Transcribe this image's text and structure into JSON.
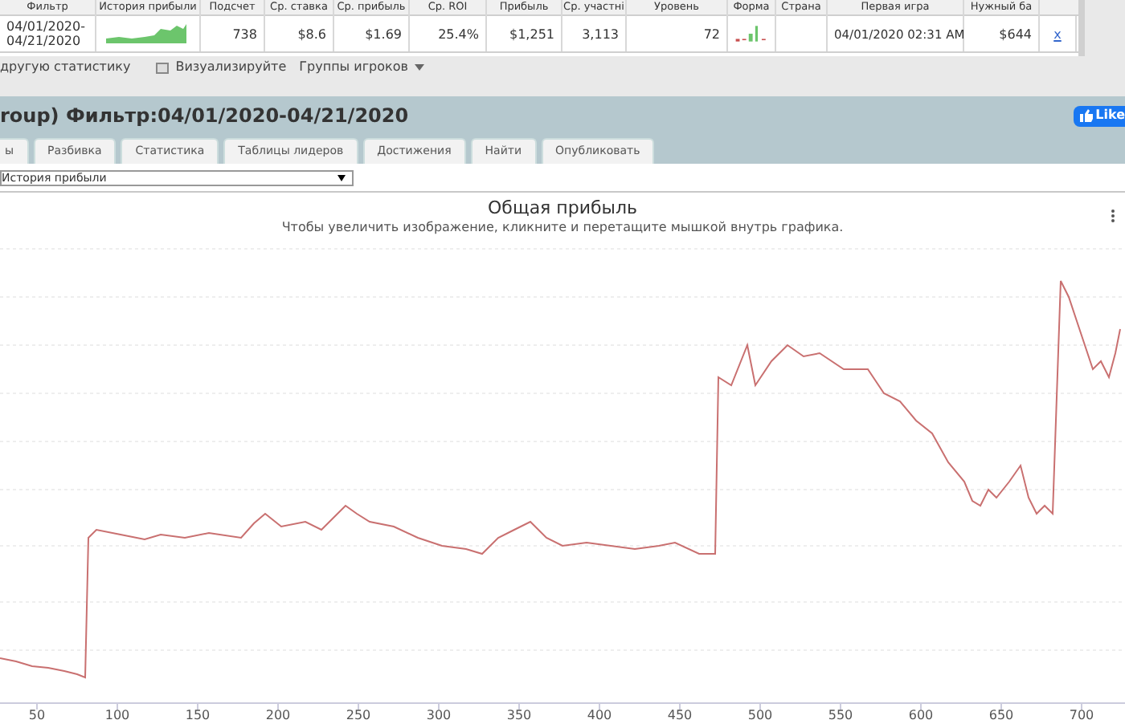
{
  "stats_table": {
    "columns": [
      "Фильтр",
      "История прибыли",
      "Подсчет",
      "Ср. ставка",
      "Ср. прибыль",
      "Ср. ROI",
      "Прибыль",
      "Ср. участні",
      "Уровень",
      "Форма",
      "Страна",
      "Первая игра",
      "Нужный ба"
    ],
    "cells": [
      {
        "kind": "text",
        "text": "04/01/2020-04/21/2020"
      },
      {
        "kind": "sparkline"
      },
      {
        "kind": "number",
        "text": "738"
      },
      {
        "kind": "number",
        "text": "$8.6"
      },
      {
        "kind": "number",
        "text": "$1.69"
      },
      {
        "kind": "number",
        "text": "25.4%"
      },
      {
        "kind": "number",
        "text": "$1,251"
      },
      {
        "kind": "number",
        "text": "3,113"
      },
      {
        "kind": "number",
        "text": "72"
      },
      {
        "kind": "form"
      },
      {
        "kind": "blank"
      },
      {
        "kind": "text",
        "text": "04/01/2020 02:31 AM"
      },
      {
        "kind": "number",
        "text": "$644"
      },
      {
        "kind": "link",
        "text": "x"
      }
    ]
  },
  "toolbar": {
    "other_stats": "другую статистику",
    "visualize": "Визуализируйте",
    "player_groups": "Группы игроков"
  },
  "header": {
    "title": "roup) Фильтр:04/01/2020-04/21/2020",
    "like_button": "Like"
  },
  "tabs": [
    {
      "label": "ы",
      "selected": false
    },
    {
      "label": "Разбивка",
      "selected": false
    },
    {
      "label": "Статистика",
      "selected": false
    },
    {
      "label": "Таблицы лидеров",
      "selected": false
    },
    {
      "label": "Достижения",
      "selected": false
    },
    {
      "label": "Найти",
      "selected": false
    },
    {
      "label": "Опубликовать",
      "selected": false
    }
  ],
  "report_select": {
    "value": "История прибыли"
  },
  "chart": {
    "title": "Общая прибыль",
    "subtitle": "Чтобы увеличить изображение, кликните и перетащите мышкой внутрь графика.",
    "x_axis_labels": [
      "50",
      "100",
      "150",
      "200",
      "250",
      "300",
      "350",
      "400",
      "450",
      "500",
      "550",
      "600",
      "650",
      "700"
    ]
  }
}
